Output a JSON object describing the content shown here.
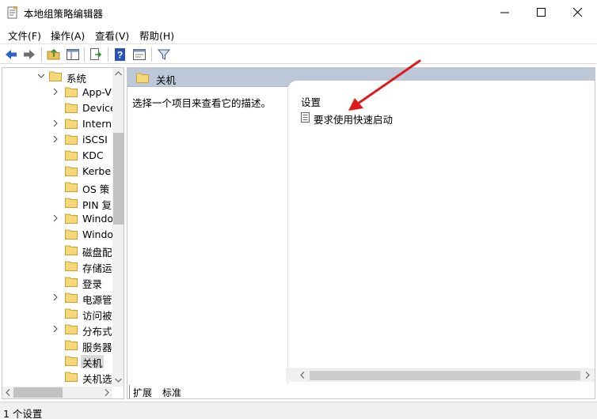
{
  "window": {
    "title": "本地组策略编辑器"
  },
  "menu": {
    "items": [
      "文件(F)",
      "操作(A)",
      "查看(V)",
      "帮助(H)"
    ]
  },
  "toolbar": {
    "icons": [
      "back-arrow-icon",
      "forward-arrow-icon",
      "up-folder-icon",
      "show-hide-tree-icon",
      "export-list-icon",
      "help-icon",
      "properties-icon",
      "filter-icon"
    ]
  },
  "tree": {
    "root_label": "系统",
    "items": [
      {
        "label": "App-V",
        "expandable": true
      },
      {
        "label": "Device",
        "expandable": false
      },
      {
        "label": "Intern",
        "expandable": true
      },
      {
        "label": "iSCSI",
        "expandable": true
      },
      {
        "label": "KDC",
        "expandable": false
      },
      {
        "label": "Kerbe",
        "expandable": false
      },
      {
        "label": "OS 策",
        "expandable": false
      },
      {
        "label": "PIN 复",
        "expandable": false
      },
      {
        "label": "Windo",
        "expandable": true
      },
      {
        "label": "Windo",
        "expandable": false
      },
      {
        "label": "磁盘配",
        "expandable": false
      },
      {
        "label": "存储运",
        "expandable": false
      },
      {
        "label": "登录",
        "expandable": false
      },
      {
        "label": "电源管",
        "expandable": true
      },
      {
        "label": "访问被",
        "expandable": false
      },
      {
        "label": "分布式",
        "expandable": true
      },
      {
        "label": "服务器",
        "expandable": false
      },
      {
        "label": "关机",
        "expandable": false,
        "selected": true
      },
      {
        "label": "关机选",
        "expandable": false
      }
    ]
  },
  "content": {
    "header_label": "关机",
    "description": "选择一个项目来查看它的描述。",
    "settings_title": "设置",
    "settings": [
      "要求使用快速启动"
    ]
  },
  "tabs": [
    {
      "label": "扩展",
      "active": true
    },
    {
      "label": "标准",
      "active": false
    }
  ],
  "status": {
    "text": "1 个设置"
  },
  "colors": {
    "header_bg": "#bcc8d8",
    "folder_fill": "#f6d77a",
    "annotation_arrow": "#e0191b",
    "toolbar_blue": "#2a63c9"
  }
}
